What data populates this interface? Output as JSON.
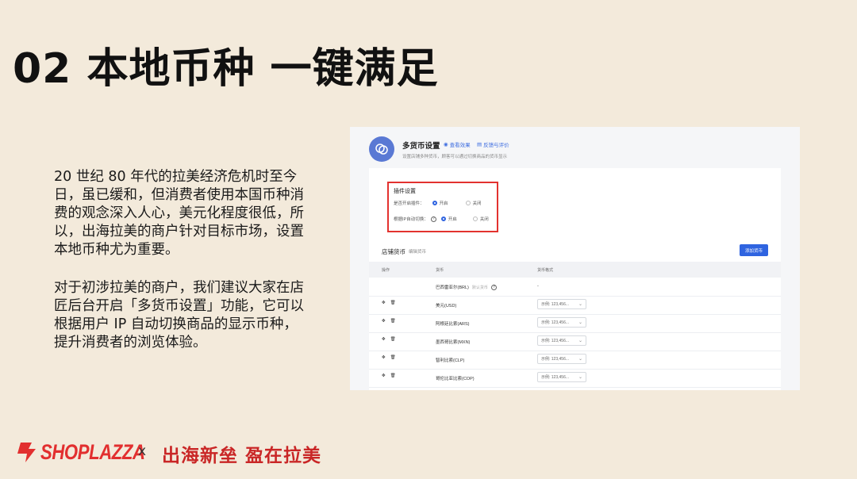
{
  "slide": {
    "title": "02 本地币种 一键满足",
    "paragraph1": "20 世纪 80 年代的拉美经济危机时至今日，虽已缓和，但消费者使用本国币种消费的观念深入人心，美元化程度很低，所以，出海拉美的商户针对目标市场，设置本地币种尤为重要。",
    "paragraph2": "对于初涉拉美的商户，我们建议大家在店匠后台开启「多货币设置」功能，它可以根据用户 IP 自动切换商品的显示币种，提升消费者的浏览体验。"
  },
  "screenshot": {
    "header": {
      "title": "多货币设置",
      "link1": "查看效果",
      "link2": "反馈与评价",
      "subtitle": "设置店铺多种货币，顾客可以通过切换商品的货币显示"
    },
    "plugin_settings": {
      "title": "插件设置",
      "row1_label": "是否开启插件：",
      "row1_on": "开启",
      "row1_off": "关闭",
      "row2_label": "根据IP自动切换：",
      "row2_on": "开启",
      "row2_off": "关闭"
    },
    "store_currency": {
      "label": "店铺货币",
      "link": "编辑货币",
      "add_button": "添加货币"
    },
    "table": {
      "headers": [
        "操作",
        "货币",
        "货币格式"
      ],
      "rows": [
        {
          "currency": "巴西雷亚尔(BRL)",
          "tag": "默认货币",
          "format": "-"
        },
        {
          "currency": "美元(USD)",
          "format": "示例: 123,456..."
        },
        {
          "currency": "阿根廷比索(ARS)",
          "format": "示例: 123,456..."
        },
        {
          "currency": "墨西哥比索(MXN)",
          "format": "示例: 123,456..."
        },
        {
          "currency": "智利比索(CLP)",
          "format": "示例: 123,456..."
        },
        {
          "currency": "哥伦比亚比索(COP)",
          "format": "示例: 123,456..."
        }
      ]
    }
  },
  "footer": {
    "brand": "SHOPLAZZA",
    "cross": "x",
    "slogan": "出海新垒 盈在拉美"
  },
  "colors": {
    "background": "#f3eadb",
    "brand_red": "#e22f2f",
    "accent_blue": "#2f64e0",
    "highlight_red": "#e3322f"
  }
}
